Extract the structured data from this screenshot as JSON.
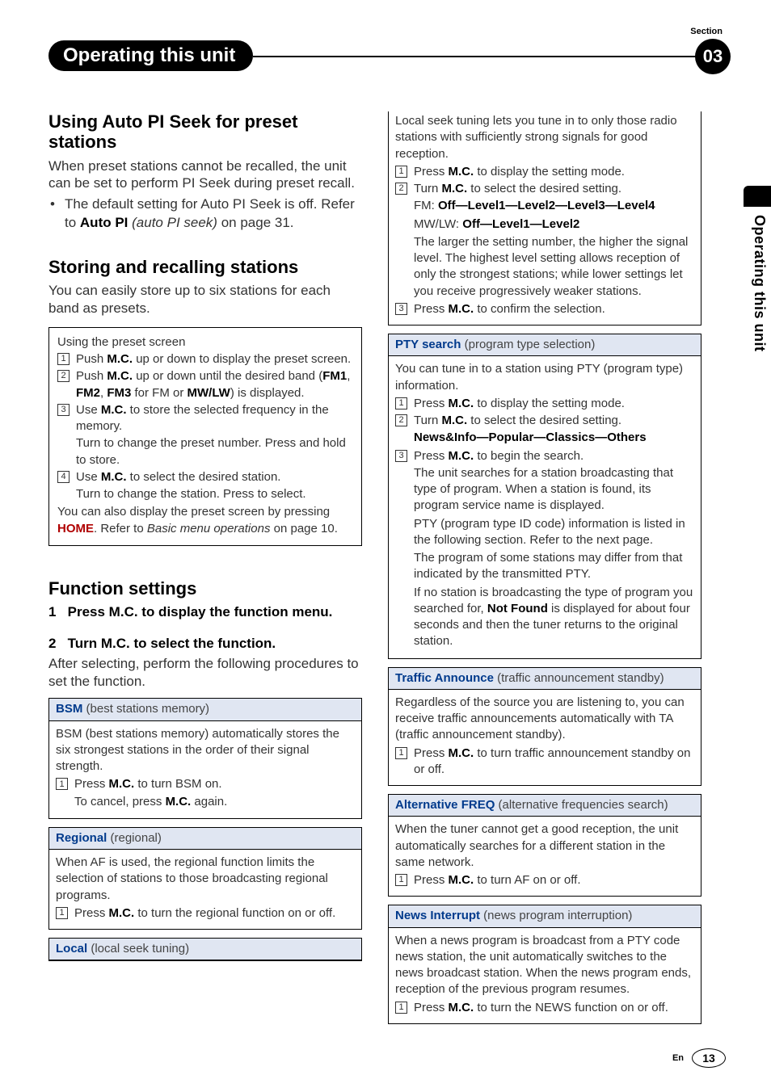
{
  "header": {
    "chapter": "Operating this unit",
    "section_label": "Section",
    "section_num": "03"
  },
  "side_tab": "Operating this unit",
  "left": {
    "h_autopi": "Using Auto PI Seek for preset stations",
    "autopi_p": "When preset stations cannot be recalled, the unit can be set to perform PI Seek during preset recall.",
    "autopi_b_pre": "The default setting for Auto PI Seek is off. Refer to ",
    "autopi_b_bold": "Auto PI",
    "autopi_b_ital": " (auto PI seek)",
    "autopi_b_post": " on page 31.",
    "h_store": "Storing and recalling stations",
    "store_p": "You can easily store up to six stations for each band as presets.",
    "preset_title": "Using the preset screen",
    "p1a": "Push ",
    "p1b": "M.C.",
    "p1c": " up or down to display the preset screen.",
    "p2a": "Push ",
    "p2b": "M.C.",
    "p2c": " up or down until the desired band (",
    "p2d": "FM1",
    "p2e": ", ",
    "p2f": "FM2",
    "p2g": ", ",
    "p2h": "FM3",
    "p2i": " for FM or ",
    "p2j": "MW/LW",
    "p2k": ") is displayed.",
    "p3a": "Use ",
    "p3b": "M.C.",
    "p3c": " to store the selected frequency in the memory.",
    "p3d": "Turn to change the preset number. Press and hold to store.",
    "p4a": "Use ",
    "p4b": "M.C.",
    "p4c": " to select the desired station.",
    "p4d": "Turn to change the station. Press to select.",
    "preset_foot1": "You can also display the preset screen by pressing ",
    "preset_foot_home": "HOME",
    "preset_foot2": ". Refer to ",
    "preset_foot_ital": "Basic menu operations",
    "preset_foot3": " on page 10.",
    "h_func": "Function settings",
    "fs1_num": "1",
    "fs1": "Press M.C. to display the function menu.",
    "fs2_num": "2",
    "fs2": "Turn M.C. to select the function.",
    "fs_p": "After selecting, perform the following procedures to set the function.",
    "bsm_lbl": "BSM",
    "bsm_sub": " (best stations memory)",
    "bsm_p": "BSM (best stations memory) automatically stores the six strongest stations in the order of their signal strength.",
    "bsm_s1a": "Press ",
    "bsm_s1b": "M.C.",
    "bsm_s1c": " to turn BSM on.",
    "bsm_s1d": "To cancel, press ",
    "bsm_s1e": "M.C.",
    "bsm_s1f": " again.",
    "reg_lbl": "Regional",
    "reg_sub": " (regional)",
    "reg_p": "When AF is used, the regional function limits the selection of stations to those broadcasting regional programs.",
    "reg_s1a": "Press ",
    "reg_s1b": "M.C.",
    "reg_s1c": " to turn the regional function on or off.",
    "loc_lbl": "Local",
    "loc_sub": " (local seek tuning)"
  },
  "right": {
    "loc_p": "Local seek tuning lets you tune in to only those radio stations with sufficiently strong signals for good reception.",
    "loc_s1a": "Press ",
    "loc_s1b": "M.C.",
    "loc_s1c": " to display the setting mode.",
    "loc_s2a": "Turn ",
    "loc_s2b": "M.C.",
    "loc_s2c": " to select the desired setting.",
    "loc_fm_pre": "FM: ",
    "loc_fm": "Off—Level1—Level2—Level3—Level4",
    "loc_mw_pre": "MW/LW: ",
    "loc_mw": "Off—Level1—Level2",
    "loc_expl": "The larger the setting number, the higher the signal level. The highest level setting allows reception of only the strongest stations; while lower settings let you receive progressively weaker stations.",
    "loc_s3a": "Press ",
    "loc_s3b": "M.C.",
    "loc_s3c": " to confirm the selection.",
    "pty_lbl": "PTY search",
    "pty_sub": " (program type selection)",
    "pty_p": "You can tune in to a station using PTY (program type) information.",
    "pty_s1a": "Press ",
    "pty_s1b": "M.C.",
    "pty_s1c": " to display the setting mode.",
    "pty_s2a": "Turn ",
    "pty_s2b": "M.C.",
    "pty_s2c": " to select the desired setting.",
    "pty_opts": "News&Info—Popular—Classics—Others",
    "pty_s3a": "Press ",
    "pty_s3b": "M.C.",
    "pty_s3c": " to begin the search.",
    "pty_e1": "The unit searches for a station broadcasting that type of program. When a station is found, its program service name is displayed.",
    "pty_e2": "PTY (program type ID code) information is listed in the following section. Refer to the next page.",
    "pty_e3": "The program of some stations may differ from that indicated by the transmitted PTY.",
    "pty_e4a": "If no station is broadcasting the type of program you searched for, ",
    "pty_e4b": "Not Found",
    "pty_e4c": " is displayed for about four seconds and then the tuner returns to the original station.",
    "ta_lbl": "Traffic Announce",
    "ta_sub": " (traffic announcement standby)",
    "ta_p": "Regardless of the source you are listening to, you can receive traffic announcements automatically with TA (traffic announcement standby).",
    "ta_s1a": "Press ",
    "ta_s1b": "M.C.",
    "ta_s1c": " to turn traffic announcement standby on or off.",
    "af_lbl": "Alternative FREQ",
    "af_sub": " (alternative frequencies search)",
    "af_p": "When the tuner cannot get a good reception, the unit automatically searches for a different station in the same network.",
    "af_s1a": "Press ",
    "af_s1b": "M.C.",
    "af_s1c": " to turn AF on or off.",
    "ni_lbl": "News Interrupt",
    "ni_sub": " (news program interruption)",
    "ni_p": "When a news program is broadcast from a PTY code news station, the unit automatically switches to the news broadcast station. When the news program ends, reception of the previous program resumes.",
    "ni_s1a": "Press ",
    "ni_s1b": "M.C.",
    "ni_s1c": " to turn the NEWS function on or off."
  },
  "footer": {
    "lang": "En",
    "page": "13"
  }
}
